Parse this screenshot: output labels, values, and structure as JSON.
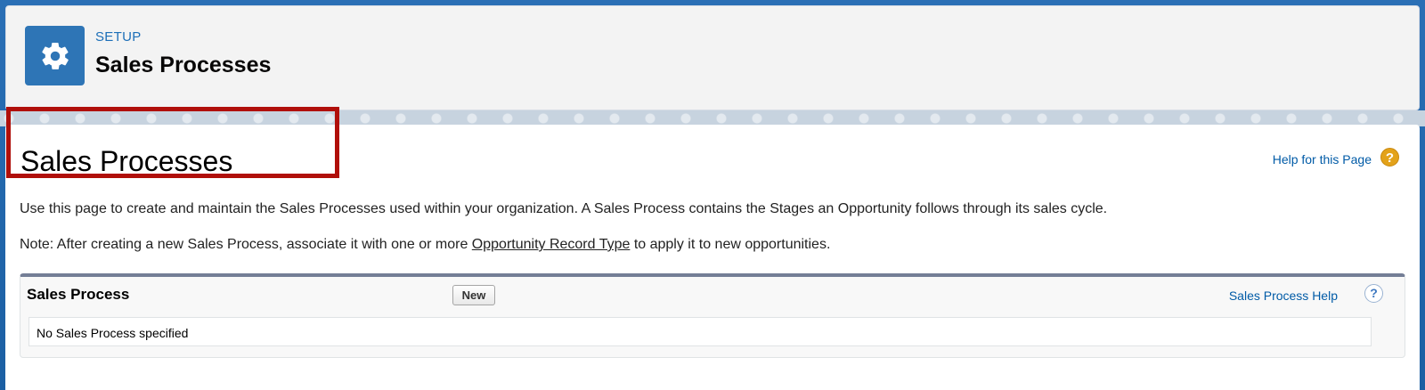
{
  "header": {
    "eyebrow": "SETUP",
    "title": "Sales Processes",
    "icon": "gear-icon"
  },
  "page": {
    "heading": "Sales Processes",
    "help_link": "Help for this Page",
    "help_icon_glyph": "?",
    "description": "Use this page to create and maintain the Sales Processes used within your organization. A Sales Process contains the Stages an Opportunity follows through its sales cycle.",
    "note_prefix": "Note: After creating a new Sales Process, associate it with one or more ",
    "note_link": "Opportunity Record Type",
    "note_suffix": " to apply it to new opportunities."
  },
  "section": {
    "title": "Sales Process",
    "new_button": "New",
    "help_link": "Sales Process Help",
    "help_icon_glyph": "?",
    "empty_message": "No Sales Process specified"
  },
  "colors": {
    "highlight": "#b00f0a",
    "link": "#015ba7",
    "icon_bg": "#2e75b6"
  }
}
